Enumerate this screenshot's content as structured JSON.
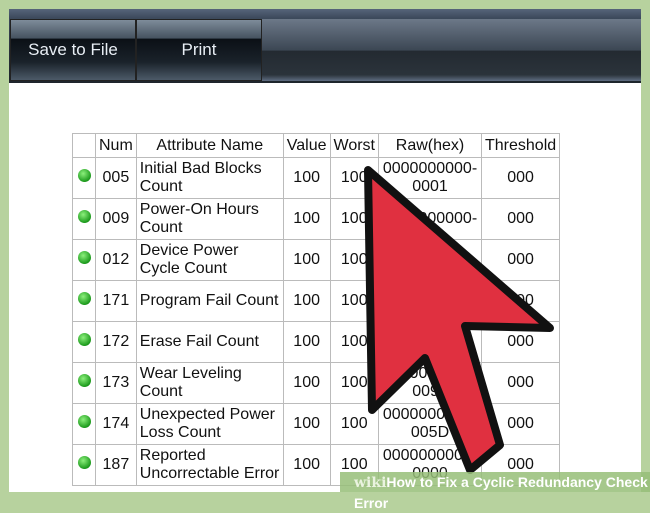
{
  "toolbar": {
    "save_label": "Save to File",
    "print_label": "Print"
  },
  "table": {
    "headers": [
      "",
      "Num",
      "Attribute Name",
      "Value",
      "Worst",
      "Raw(hex)",
      "Threshold"
    ],
    "rows": [
      {
        "num": "005",
        "name": "Initial Bad Blocks Count",
        "value": "100",
        "worst": "100",
        "raw": "0000000000-0001",
        "threshold": "000"
      },
      {
        "num": "009",
        "name": "Power-On Hours Count",
        "value": "100",
        "worst": "100",
        "raw": "0000000000-",
        "threshold": "000"
      },
      {
        "num": "012",
        "name": "Device Power Cycle Count",
        "value": "100",
        "worst": "100",
        "raw": "",
        "threshold": "000"
      },
      {
        "num": "171",
        "name": "Program Fail Count",
        "value": "100",
        "worst": "100",
        "raw": "",
        "threshold": "000"
      },
      {
        "num": "172",
        "name": "Erase Fail Count",
        "value": "100",
        "worst": "100",
        "raw": "",
        "threshold": "000"
      },
      {
        "num": "173",
        "name": "Wear Leveling Count",
        "value": "100",
        "worst": "100",
        "raw": "0000000000-0099",
        "threshold": "000"
      },
      {
        "num": "174",
        "name": "Unexpected Power Loss Count",
        "value": "100",
        "worst": "100",
        "raw": "0000000000-005D",
        "threshold": "000"
      },
      {
        "num": "187",
        "name": "Reported Uncorrectable Error",
        "value": "100",
        "worst": "100",
        "raw": "0000000000-0000",
        "threshold": "000"
      }
    ]
  },
  "watermark": {
    "brand": "wiki",
    "title": "How to Fix a Cyclic Redundancy Check Error"
  },
  "colors": {
    "status_ok": "#1c9a1c",
    "cursor": "#e03040"
  }
}
